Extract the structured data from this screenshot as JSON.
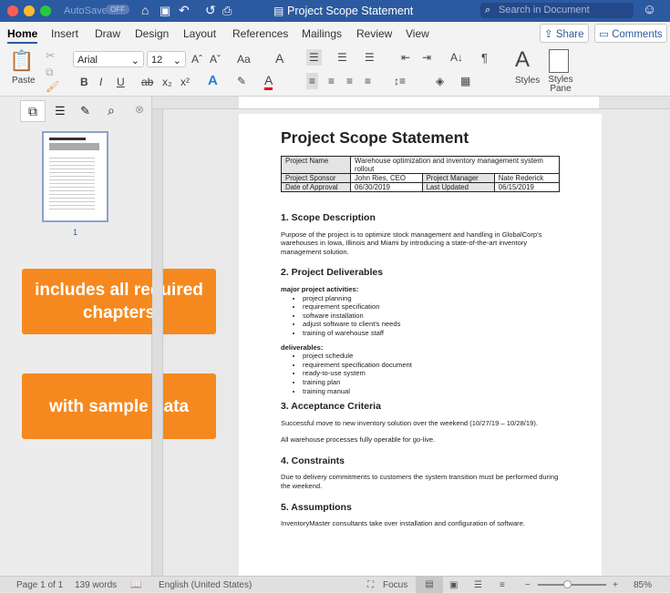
{
  "window": {
    "title": "Project Scope Statement",
    "autosave": "AutoSave",
    "autosave_state": "OFF",
    "search_placeholder": "Search in Document"
  },
  "tabs": [
    "Home",
    "Insert",
    "Draw",
    "Design",
    "Layout",
    "References",
    "Mailings",
    "Review",
    "View"
  ],
  "actions": {
    "share": "Share",
    "comments": "Comments"
  },
  "ribbon": {
    "paste": "Paste",
    "font": "Arial",
    "size": "12",
    "styles": "Styles",
    "styles_pane": "Styles Pane",
    "bold": "B",
    "italic": "I",
    "underline": "U",
    "sub": "x₂",
    "sup": "x²",
    "aa": "Aa"
  },
  "sidebar": {
    "thumb_page": "1"
  },
  "callouts": [
    "includes all required chapters",
    "with sample data"
  ],
  "doc": {
    "title": "Project Scope Statement",
    "table": {
      "project_name_label": "Project Name",
      "project_name": "Warehouse optimization and inventory management system rollout",
      "sponsor_label": "Project Sponsor",
      "sponsor": "John Ries, CEO",
      "manager_label": "Project Manager",
      "manager": "Nate Rederick",
      "approval_label": "Date of Approval",
      "approval": "06/30/2019",
      "updated_label": "Last Updated",
      "updated": "06/15/2019"
    },
    "s1": {
      "h": "1. Scope Description",
      "p": "Purpose of the project is to optimize stock management and handling in GlobalCorp's warehouses in Iowa, Illinois and Miami by introducing a state-of-the-art inventory management solution."
    },
    "s2": {
      "h": "2. Project Deliverables",
      "a_h": "major project activities:",
      "a": [
        "project planning",
        "requirement specification",
        "software installation",
        "adjust software to client's needs",
        "training of warehouse staff"
      ],
      "d_h": "deliverables:",
      "d": [
        "project schedule",
        "requirement specification document",
        "ready-to-use system",
        "training plan",
        "training manual"
      ]
    },
    "s3": {
      "h": "3. Acceptance Criteria",
      "p1": "Successful move to new inventory solution over the weekend (10/27/19 – 10/28/19).",
      "p2": "All warehouse processes fully operable for go-live."
    },
    "s4": {
      "h": "4. Constraints",
      "p": "Due to delivery commitments to customers the system transition must be performed during the weekend."
    },
    "s5": {
      "h": "5. Assumptions",
      "p": "InventoryMaster consultants take over installation and configuration of software."
    }
  },
  "status": {
    "page": "Page 1 of 1",
    "words": "139 words",
    "language": "English (United States)",
    "focus": "Focus",
    "zoom": "85%",
    "zoom_minus": "−",
    "zoom_plus": "+"
  }
}
